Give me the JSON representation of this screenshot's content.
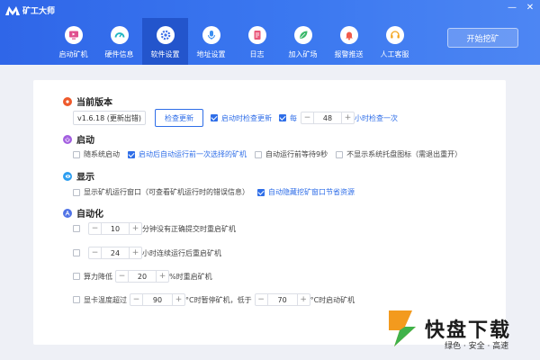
{
  "app": {
    "title": "矿工大师"
  },
  "window_controls": {
    "minimize": "—",
    "close": "✕"
  },
  "nav": [
    {
      "label": "启动矿机",
      "icon": "monitor-icon",
      "color": "#e0508f"
    },
    {
      "label": "硬件信息",
      "icon": "gauge-icon",
      "color": "#1fb6c2"
    },
    {
      "label": "软件设置",
      "icon": "gear-icon",
      "color": "#3d6fe8"
    },
    {
      "label": "地址设置",
      "icon": "microphone-icon",
      "color": "#3b8ef0"
    },
    {
      "label": "日志",
      "icon": "document-icon",
      "color": "#e9577a"
    },
    {
      "label": "加入矿场",
      "icon": "leaf-icon",
      "color": "#3bb86a"
    },
    {
      "label": "报警推送",
      "icon": "bell-icon",
      "color": "#f25a4a"
    },
    {
      "label": "人工客服",
      "icon": "headset-icon",
      "color": "#f3a51c"
    }
  ],
  "start_button": "开始挖矿",
  "sections": {
    "version": {
      "title": "当前版本",
      "icon_color": "#ee5a2c",
      "version_text": "v1.6.18 (更新出错)",
      "check_button": "检查更新",
      "auto_check_label": "启动时检查更新",
      "every_label": "每",
      "hours_value": "48",
      "hours_suffix": "小时检查一次"
    },
    "startup": {
      "title": "启动",
      "icon_color": "#a35fe0",
      "opt1": "随系统启动",
      "opt2": "启动后自动运行前一次选择的矿机",
      "opt3": "自动运行前等待9秒",
      "opt4": "不显示系统托盘图标（需退出重开）"
    },
    "display": {
      "title": "显示",
      "icon_color": "#2d9ef0",
      "opt1": "显示矿机运行窗口（可查看矿机运行时的错误信息）",
      "opt2": "自动隐藏挖矿窗口节省资源"
    },
    "auto": {
      "title": "自动化",
      "icon_color": "#4f72e6",
      "r1_value": "10",
      "r1_suffix": "分钟没有正确提交时重启矿机",
      "r2_value": "24",
      "r2_suffix": "小时连续运行后重启矿机",
      "r3_prefix": "算力降低",
      "r3_value": "20",
      "r3_suffix": "%时重启矿机",
      "r4_prefix": "显卡温度超过",
      "r4_value1": "90",
      "r4_mid": "°C时暂停矿机，低于",
      "r4_value2": "70",
      "r4_suffix": "°C时启动矿机"
    }
  },
  "watermark": {
    "brand": "快盘下载",
    "slogan": "绿色 · 安全 · 高速"
  }
}
